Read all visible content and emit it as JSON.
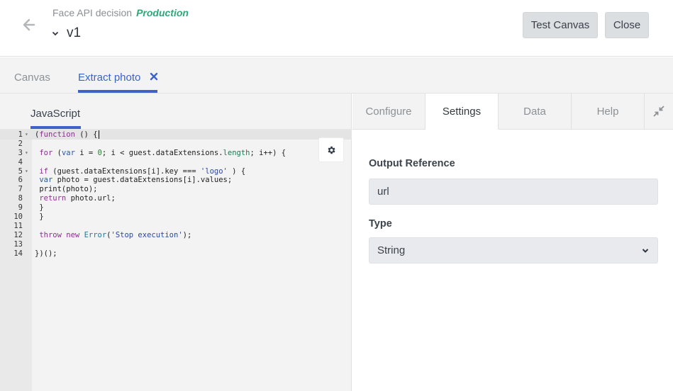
{
  "header": {
    "breadcrumb": "Face API decision",
    "environment": "Production",
    "version": "v1",
    "test_button": "Test Canvas",
    "close_button": "Close"
  },
  "tabs": [
    {
      "label": "Canvas",
      "active": false
    },
    {
      "label": "Extract photo",
      "active": true,
      "closable": true
    }
  ],
  "editor": {
    "language_tab": "JavaScript",
    "lines": [
      {
        "n": "1",
        "fold": true,
        "code": "(function () {"
      },
      {
        "n": "2",
        "fold": false,
        "code": ""
      },
      {
        "n": "3",
        "fold": true,
        "code": " for (var i = 0; i < guest.dataExtensions.length; i++) {"
      },
      {
        "n": "4",
        "fold": false,
        "code": ""
      },
      {
        "n": "5",
        "fold": true,
        "code": " if (guest.dataExtensions[i].key === 'logo' ) {"
      },
      {
        "n": "6",
        "fold": false,
        "code": " var photo = guest.dataExtensions[i].values;"
      },
      {
        "n": "7",
        "fold": false,
        "code": " print(photo);"
      },
      {
        "n": "8",
        "fold": false,
        "code": " return photo.url;"
      },
      {
        "n": "9",
        "fold": false,
        "code": " }"
      },
      {
        "n": "10",
        "fold": false,
        "code": " }"
      },
      {
        "n": "11",
        "fold": false,
        "code": ""
      },
      {
        "n": "12",
        "fold": false,
        "code": " throw new Error('Stop execution');"
      },
      {
        "n": "13",
        "fold": false,
        "code": ""
      },
      {
        "n": "14",
        "fold": false,
        "code": "})();"
      }
    ],
    "settings_icon": "gear-icon"
  },
  "panel": {
    "tabs": [
      {
        "label": "Configure",
        "active": false
      },
      {
        "label": "Settings",
        "active": true
      },
      {
        "label": "Data",
        "active": false
      },
      {
        "label": "Help",
        "active": false
      }
    ],
    "collapse_icon": "collapse-arrows-icon",
    "output_reference_label": "Output Reference",
    "output_reference_value": "url",
    "type_label": "Type",
    "type_value": "String"
  },
  "colors": {
    "accent": "#3d63c9",
    "production": "#2fa778"
  }
}
